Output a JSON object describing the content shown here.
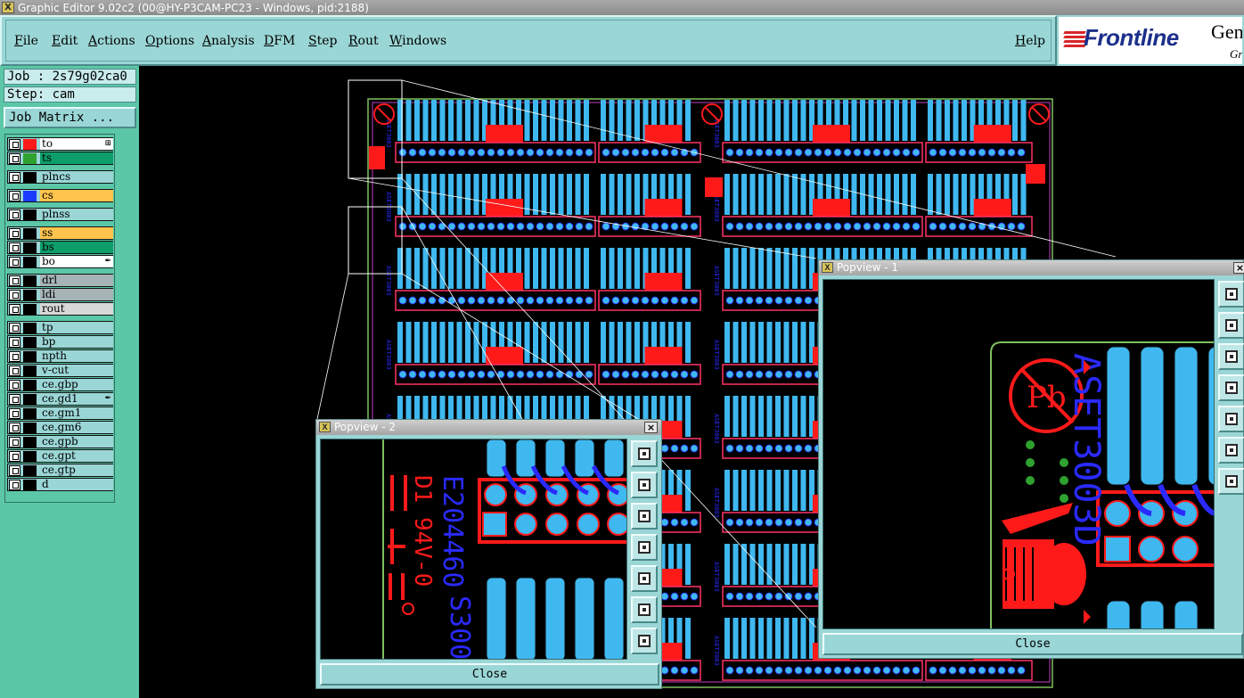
{
  "window": {
    "title": "Graphic Editor 9.02c2 (00@HY-P3CAM-PC23 - Windows, pid:2188)"
  },
  "menubar": {
    "items": [
      "File",
      "Edit",
      "Actions",
      "Options",
      "Analysis",
      "DFM",
      "Step",
      "Rout",
      "Windows"
    ],
    "help": "Help"
  },
  "logo": {
    "brand": "Frontline",
    "product": "Gen",
    "sub": "Gr"
  },
  "job": {
    "label": "Job : 2s79g02ca0",
    "step": "Step: cam",
    "matrix_button": "Job Matrix ..."
  },
  "layers": [
    {
      "name": "to",
      "swatch": "#ff1a1a",
      "bg": "#ffffff",
      "mark": "⊞"
    },
    {
      "name": "ts",
      "swatch": "#2fa12f",
      "bg": "#0d9e6a",
      "mark": ""
    },
    {
      "name": "plncs",
      "swatch": "",
      "bg": "#9bd6d6",
      "mark": ""
    },
    {
      "name": "cs",
      "swatch": "#1a3cff",
      "bg": "#ffc44d",
      "mark": ""
    },
    {
      "name": "plnss",
      "swatch": "",
      "bg": "#9bd6d6",
      "mark": ""
    },
    {
      "name": "ss",
      "swatch": "",
      "bg": "#ffc44d",
      "mark": ""
    },
    {
      "name": "bs",
      "swatch": "",
      "bg": "#0d9e6a",
      "mark": ""
    },
    {
      "name": "bo",
      "swatch": "",
      "bg": "#ffffff",
      "mark": "✒"
    },
    {
      "name": "drl",
      "swatch": "",
      "bg": "#a6b4b8",
      "mark": ""
    },
    {
      "name": "ldi",
      "swatch": "",
      "bg": "#a6b4b8",
      "mark": ""
    },
    {
      "name": "rout",
      "swatch": "",
      "bg": "#d8d8d8",
      "mark": ""
    },
    {
      "name": "tp",
      "swatch": "",
      "bg": "#9bd6d6",
      "mark": ""
    },
    {
      "name": "bp",
      "swatch": "",
      "bg": "#9bd6d6",
      "mark": ""
    },
    {
      "name": "npth",
      "swatch": "",
      "bg": "#9bd6d6",
      "mark": ""
    },
    {
      "name": "v-cut",
      "swatch": "",
      "bg": "#9bd6d6",
      "mark": ""
    },
    {
      "name": "ce.gbp",
      "swatch": "",
      "bg": "#9bd6d6",
      "mark": ""
    },
    {
      "name": "ce.gd1",
      "swatch": "",
      "bg": "#9bd6d6",
      "mark": "✒"
    },
    {
      "name": "ce.gm1",
      "swatch": "",
      "bg": "#9bd6d6",
      "mark": ""
    },
    {
      "name": "ce.gm6",
      "swatch": "",
      "bg": "#9bd6d6",
      "mark": ""
    },
    {
      "name": "ce.gpb",
      "swatch": "",
      "bg": "#9bd6d6",
      "mark": ""
    },
    {
      "name": "ce.gpt",
      "swatch": "",
      "bg": "#9bd6d6",
      "mark": ""
    },
    {
      "name": "ce.gtp",
      "swatch": "",
      "bg": "#9bd6d6",
      "mark": ""
    },
    {
      "name": "d",
      "swatch": "",
      "bg": "#9bd6d6",
      "mark": ""
    }
  ],
  "popview1": {
    "title": "Popview - 1",
    "close": "Close",
    "close_x": "×",
    "silk_text": "ASET3003D"
  },
  "popview2": {
    "title": "Popview - 2",
    "close": "Close",
    "close_x": "×",
    "silk_text_1": "E204460",
    "silk_text_2": "D1 94V-0",
    "silk_text_3": "S300"
  },
  "colors": {
    "copper": "#3fb8f0",
    "pad_red": "#ff1a1a",
    "outline": "#ff3366",
    "silk_blue": "#2a2aff",
    "panel_bg": "#9bd6d6",
    "green_bg": "#5bc7a6"
  }
}
